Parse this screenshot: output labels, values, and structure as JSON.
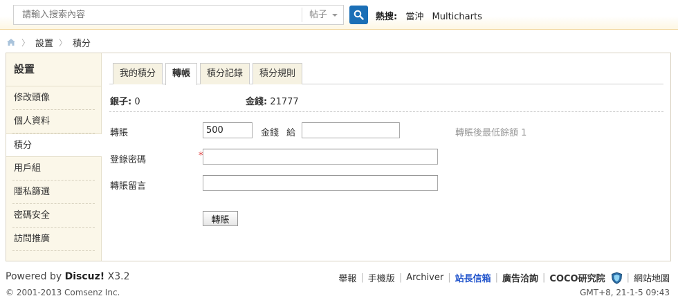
{
  "search": {
    "placeholder": "請輸入搜索內容",
    "type_selected": "帖子",
    "hot_label": "熱搜:",
    "hot_links": [
      "當沖",
      "Multicharts"
    ]
  },
  "breadcrumb": {
    "items": [
      "設置",
      "積分"
    ]
  },
  "sidebar": {
    "title": "設置",
    "items": [
      {
        "label": "修改頭像"
      },
      {
        "label": "個人資料"
      },
      {
        "label": "積分"
      },
      {
        "label": "用戶組"
      },
      {
        "label": "隱私篩選"
      },
      {
        "label": "密碼安全"
      },
      {
        "label": "訪問推廣"
      }
    ],
    "active_index": 2
  },
  "tabs": [
    {
      "label": "我的積分"
    },
    {
      "label": "轉帳"
    },
    {
      "label": "積分記錄"
    },
    {
      "label": "積分規則"
    }
  ],
  "balances": {
    "silver_label": "銀子:",
    "silver_value": "0",
    "gold_label": "金錢:",
    "gold_value": "21777"
  },
  "form": {
    "transfer_label": "轉賬",
    "transfer_amount": "500",
    "currency": "金錢",
    "to_label": "給",
    "recipient": "",
    "hint": "轉賬後最低餘額 1",
    "password_label": "登錄密碼",
    "required_mark": "*",
    "password": "",
    "message_label": "轉賬留言",
    "message": "",
    "submit_label": "轉賬"
  },
  "footer": {
    "powered_prefix": "Powered by",
    "powered_brand": "Discuz!",
    "powered_version": "X3.2",
    "copyright": "© 2001-2013 Comsenz Inc.",
    "links": [
      "舉報",
      "手機版",
      "Archiver",
      "站長信箱",
      "廣告洽詢",
      "COCO研究院",
      "網站地圖"
    ],
    "timestamp": "GMT+8, 21-1-5 09:43"
  },
  "colors": {
    "accent_blue": "#1b6fb6",
    "panel_bg": "#fbf7e9",
    "required_red": "#e03c3c"
  },
  "icons": {
    "search_button": "search-icon",
    "breadcrumb_home": "home-icon",
    "footer_badge": "shield-icon"
  }
}
